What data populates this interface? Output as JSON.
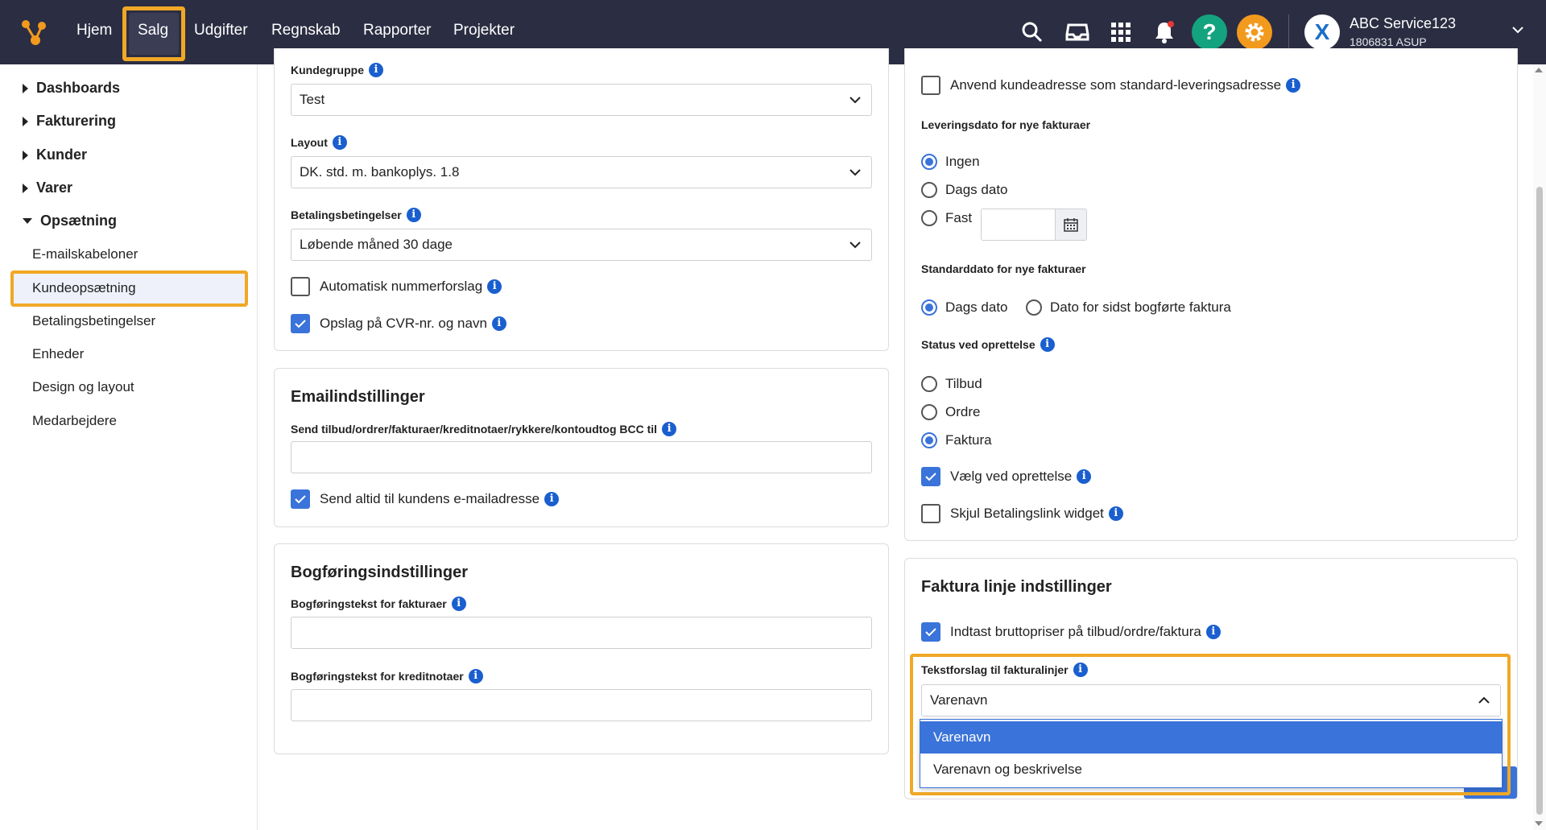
{
  "nav": {
    "items": [
      "Hjem",
      "Salg",
      "Udgifter",
      "Regnskab",
      "Rapporter",
      "Projekter"
    ],
    "active": "Salg",
    "help_label": "?",
    "company_name": "ABC Service123",
    "company_sub": "1806831 ASUP",
    "avatar_letter": "X",
    "accent_color": "#f0a825"
  },
  "sidebar": {
    "groups": [
      "Dashboards",
      "Fakturering",
      "Kunder",
      "Varer",
      "Opsætning"
    ],
    "sub_items": [
      "E-mailskabeloner",
      "Kundeopsætning",
      "Betalingsbetingelser",
      "Enheder",
      "Design og layout",
      "Medarbejdere"
    ],
    "active_sub": "Kundeopsætning"
  },
  "left": {
    "kundegruppe_label": "Kundegruppe",
    "kundegruppe_value": "Test",
    "layout_label": "Layout",
    "layout_value": "DK. std. m. bankoplys. 1.8",
    "betaling_label": "Betalingsbetingelser",
    "betaling_value": "Løbende måned 30 dage",
    "auto_nr_label": "Automatisk nummerforslag",
    "cvr_label": "Opslag på CVR-nr. og navn",
    "email_title": "Emailindstillinger",
    "bcc_label": "Send tilbud/ordrer/fakturaer/kreditnotaer/rykkere/kontoudtog BCC til",
    "send_altid_label": "Send altid til kundens e-mailadresse",
    "bogf_title": "Bogføringsindstillinger",
    "bogf_faktura_label": "Bogføringstekst for fakturaer",
    "bogf_kredit_label": "Bogføringstekst for kreditnotaer"
  },
  "right": {
    "anvend_label": "Anvend kundeadresse som standard-leveringsadresse",
    "levering_label": "Leveringsdato for nye fakturaer",
    "levering_options": [
      "Ingen",
      "Dags dato",
      "Fast"
    ],
    "levering_selected": "Ingen",
    "standarddato_label": "Standarddato for nye fakturaer",
    "standarddato_options": [
      "Dags dato",
      "Dato for sidst bogførte faktura"
    ],
    "standarddato_selected": "Dags dato",
    "status_label": "Status ved oprettelse",
    "status_options": [
      "Tilbud",
      "Ordre",
      "Faktura"
    ],
    "status_selected": "Faktura",
    "vaelg_label": "Vælg ved oprettelse",
    "skjul_label": "Skjul Betalingslink widget",
    "linje_title": "Faktura linje indstillinger",
    "brutto_label": "Indtast bruttopriser på tilbud/ordre/faktura",
    "tekstforslag_label": "Tekstforslag til fakturalinjer",
    "tekstforslag_value": "Varenavn",
    "tekstforslag_options": [
      "Varenavn",
      "Varenavn og beskrivelse"
    ]
  }
}
